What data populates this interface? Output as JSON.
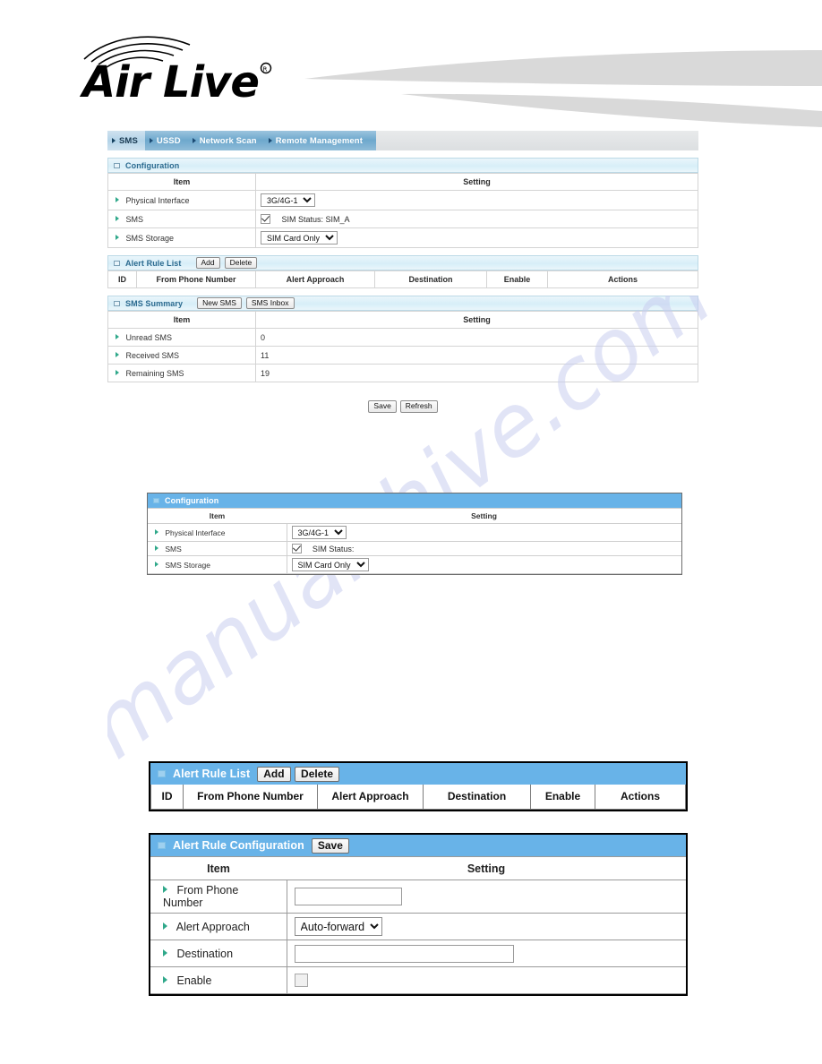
{
  "branding": {
    "logo_text": "Air Live",
    "logo_mark": "registered-trademark"
  },
  "watermark": {
    "text": "manualshive.com"
  },
  "tabs": [
    {
      "label": "SMS",
      "active": true
    },
    {
      "label": "USSD",
      "active": false
    },
    {
      "label": "Network Scan",
      "active": false
    },
    {
      "label": "Remote Management",
      "active": false
    }
  ],
  "configuration_panel": {
    "title": "Configuration",
    "columns": {
      "item": "Item",
      "setting": "Setting"
    },
    "rows": [
      {
        "item": "Physical Interface",
        "control": "select",
        "value": "3G/4G-1"
      },
      {
        "item": "SMS",
        "control": "checkbox",
        "checked": true,
        "label": "SIM Status:  SIM_A"
      },
      {
        "item": "SMS Storage",
        "control": "select",
        "value": "SIM Card Only"
      }
    ]
  },
  "alert_rule_list_panel": {
    "title": "Alert Rule List",
    "buttons": {
      "add": "Add",
      "delete": "Delete"
    },
    "columns": [
      "ID",
      "From Phone Number",
      "Alert Approach",
      "Destination",
      "Enable",
      "Actions"
    ]
  },
  "sms_summary_panel": {
    "title": "SMS Summary",
    "buttons": {
      "new_sms": "New SMS",
      "sms_inbox": "SMS Inbox"
    },
    "columns": {
      "item": "Item",
      "setting": "Setting"
    },
    "rows": [
      {
        "item": "Unread SMS",
        "value": "0"
      },
      {
        "item": "Received SMS",
        "value": "11"
      },
      {
        "item": "Remaining SMS",
        "value": "19"
      }
    ]
  },
  "page_actions": {
    "save": "Save",
    "refresh": "Refresh"
  },
  "configuration_panel_detail": {
    "title": "Configuration",
    "columns": {
      "item": "Item",
      "setting": "Setting"
    },
    "rows": [
      {
        "item": "Physical Interface",
        "control": "select",
        "value": "3G/4G-1"
      },
      {
        "item": "SMS",
        "control": "checkbox",
        "checked": true,
        "label": "SIM Status:"
      },
      {
        "item": "SMS Storage",
        "control": "select",
        "value": "SIM Card Only"
      }
    ]
  },
  "alert_rule_list_detail": {
    "title": "Alert Rule List",
    "buttons": {
      "add": "Add",
      "delete": "Delete"
    },
    "columns": [
      "ID",
      "From Phone Number",
      "Alert Approach",
      "Destination",
      "Enable",
      "Actions"
    ]
  },
  "alert_rule_configuration": {
    "title": "Alert Rule Configuration",
    "buttons": {
      "save": "Save"
    },
    "columns": {
      "item": "Item",
      "setting": "Setting"
    },
    "rows": [
      {
        "item": "From Phone Number",
        "control": "text",
        "value": ""
      },
      {
        "item": "Alert Approach",
        "control": "select",
        "value": "Auto-forward"
      },
      {
        "item": "Destination",
        "control": "text",
        "value": ""
      },
      {
        "item": "Enable",
        "control": "checkbox",
        "checked": false
      }
    ]
  },
  "colors": {
    "tab_bar_blue": "#6ea8cd",
    "panel_head_light": "#d7eef8",
    "panel_head_solid": "#68b3e8",
    "bullet_green": "#2fa88a",
    "watermark": "#c9cef0",
    "swoosh_gray": "#d9d9d9"
  }
}
